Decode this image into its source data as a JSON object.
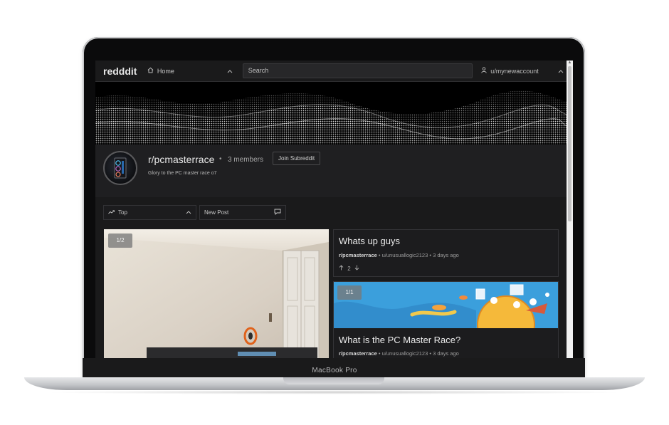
{
  "device": {
    "label": "MacBook Pro"
  },
  "nav": {
    "logo": "redddit",
    "home_label": "Home",
    "search_placeholder": "Search",
    "user_label": "u/mynewaccount"
  },
  "subreddit": {
    "name": "r/pcmasterrace",
    "separator": "•",
    "members": "3 members",
    "join_label": "Join Subreddit",
    "description": "Glory to the PC master race o7"
  },
  "controls": {
    "sort_label": "Top",
    "new_post_label": "New Post"
  },
  "posts": [
    {
      "image_counter": "1/2"
    },
    {
      "title": "Whats up guys",
      "subreddit": "r/pcmasterrace",
      "author": "u/unusuallogic2123",
      "time": "3 days ago",
      "score": "2"
    },
    {
      "image_counter": "1/1",
      "title": "What is the PC Master Race?",
      "subreddit": "r/pcmasterrace",
      "author": "u/unusuallogic2123",
      "time": "3 days ago"
    }
  ],
  "meta_separator": "•",
  "icons": {
    "home": "home-icon",
    "chevron": "chevron-up-icon",
    "user": "user-icon",
    "trending": "trending-icon",
    "comment": "comment-icon",
    "upvote": "upvote-icon",
    "downvote": "downvote-icon"
  },
  "colors": {
    "background": "#1a1a1b",
    "card": "#1c1c1e",
    "text": "#e8e8e8"
  }
}
